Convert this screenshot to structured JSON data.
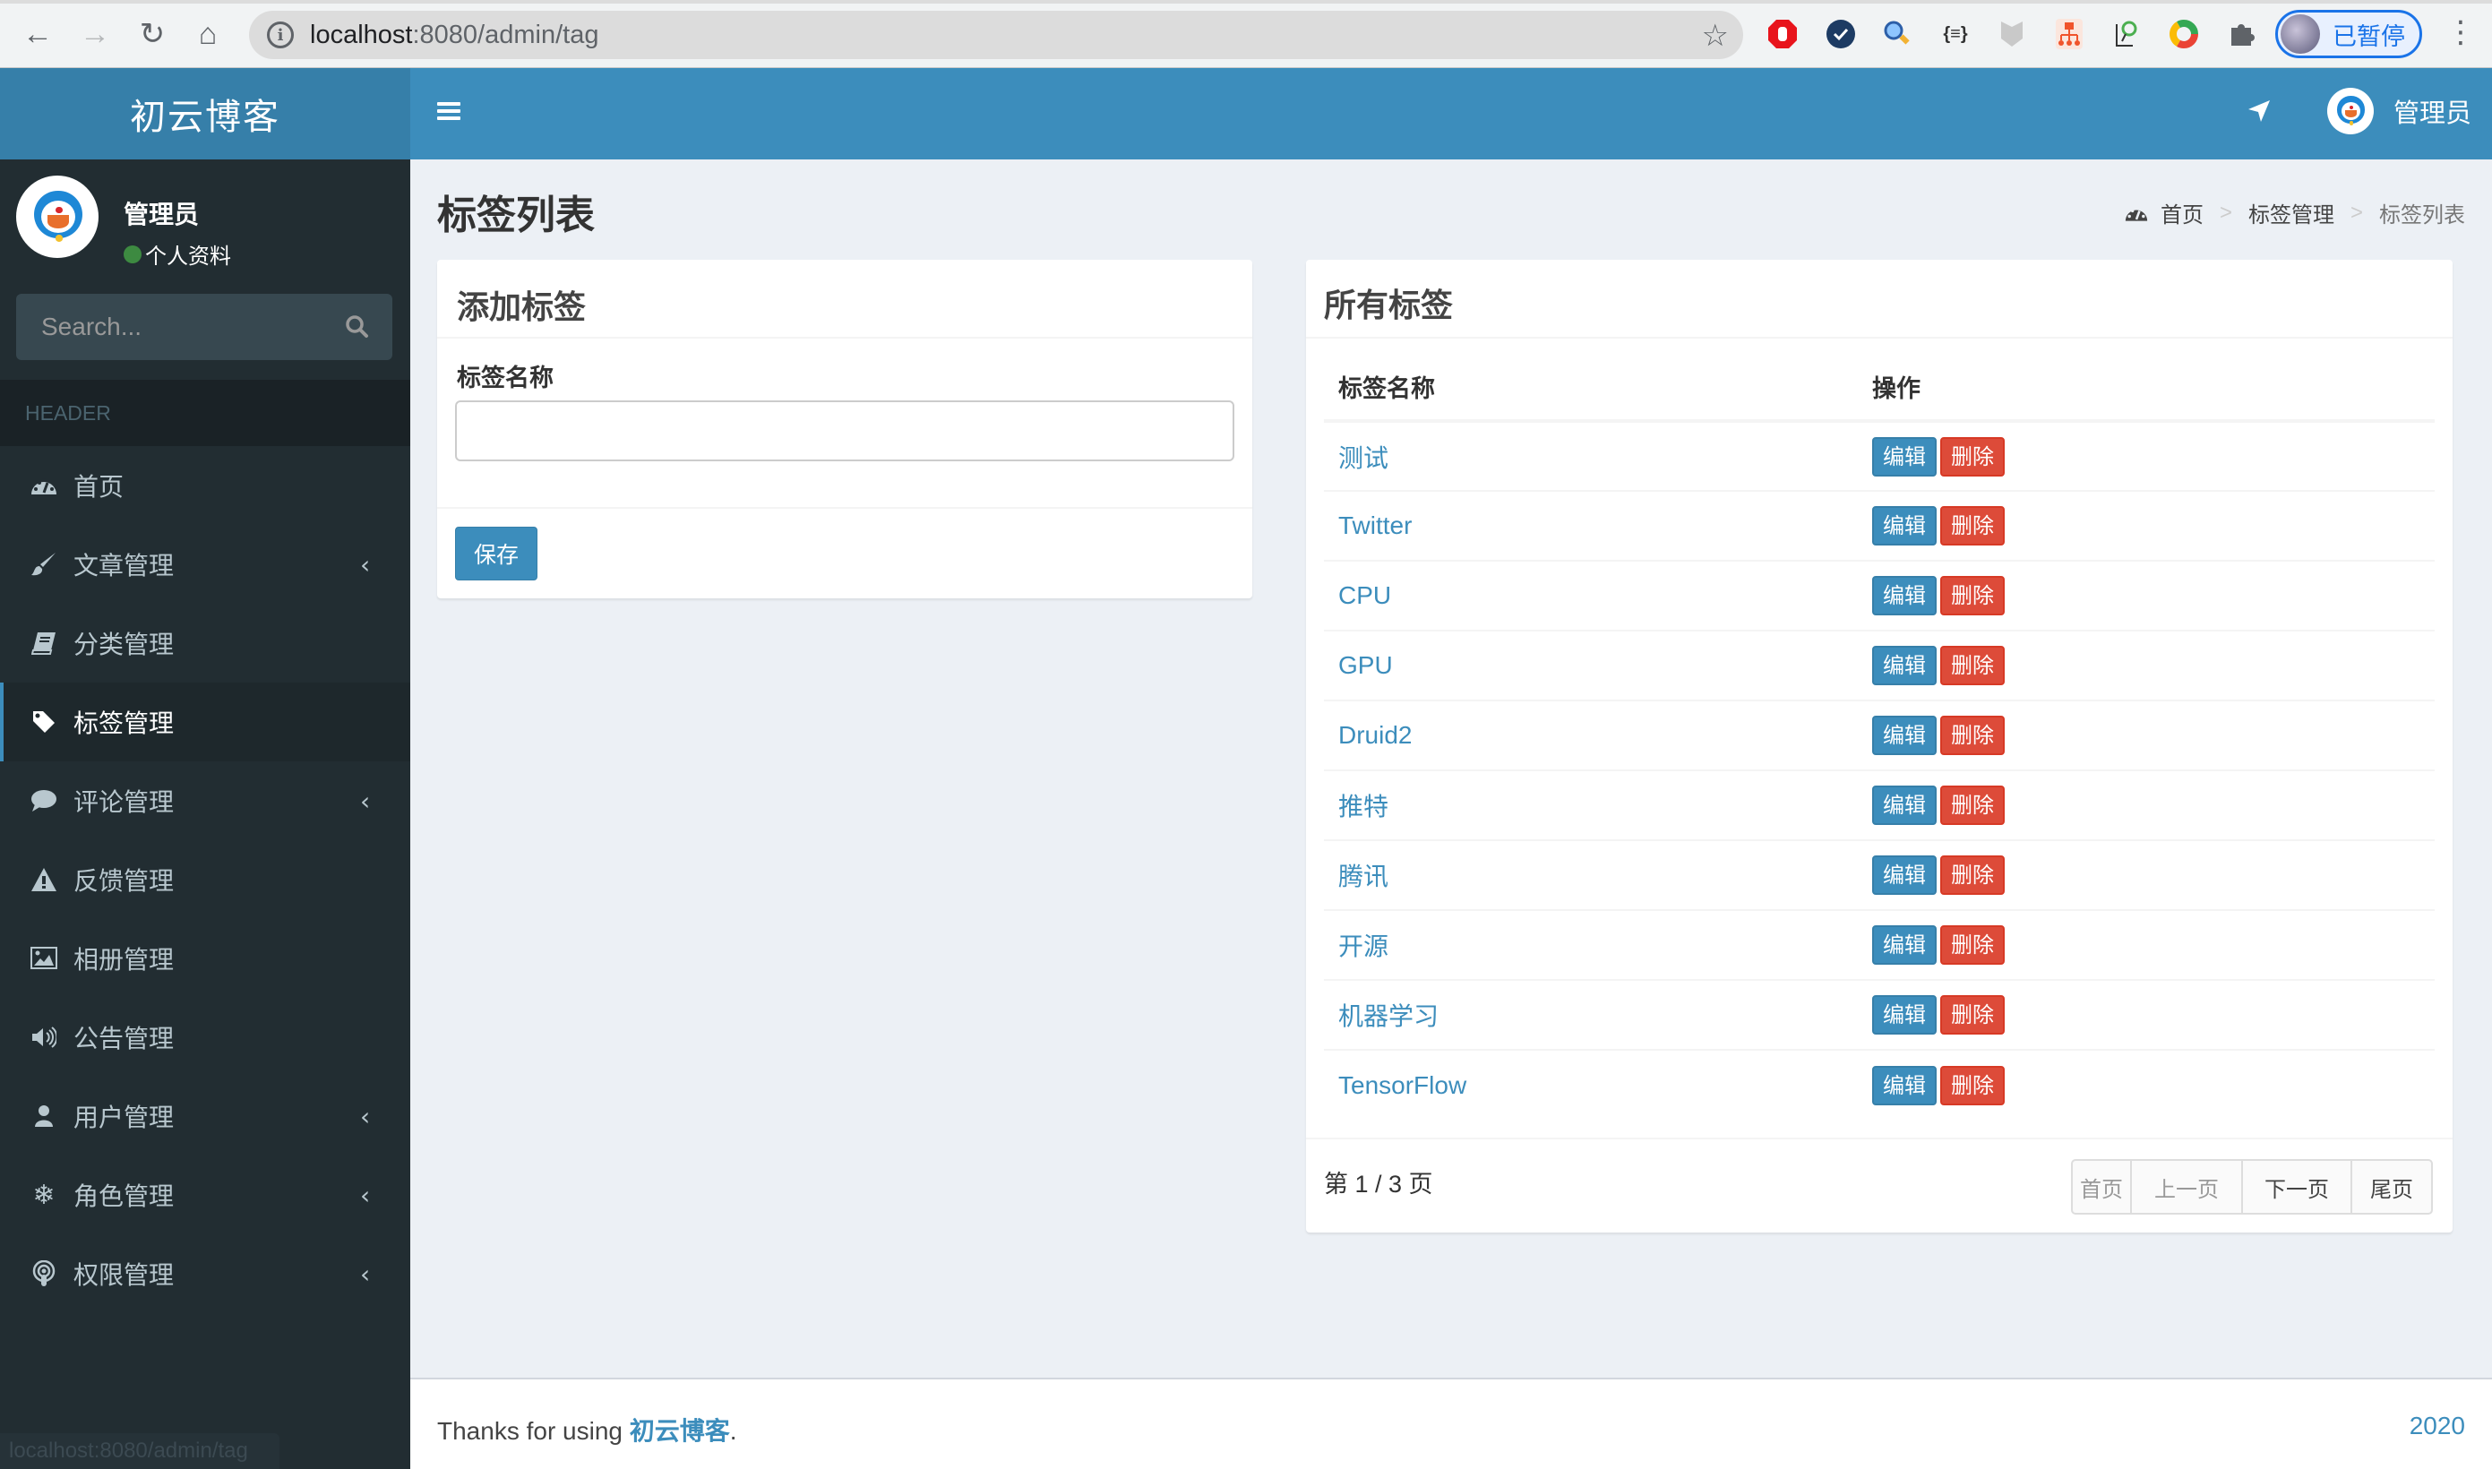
{
  "browser": {
    "url_host": "localhost",
    "url_path": ":8080/admin/tag",
    "profile_label": "已暂停",
    "extensions": [
      "adblock-icon",
      "checkmark-icon",
      "magnifier-icon",
      "json-formatter-icon",
      "shield-icon",
      "sitemap-icon",
      "search-doc-icon",
      "chrome-ring-icon",
      "puzzle-icon"
    ]
  },
  "app": {
    "logo": "初云博客",
    "user_name": "管理员",
    "user_status": "个人资料",
    "search_placeholder": "Search...",
    "sidebar_header": "HEADER"
  },
  "sidebar": {
    "items": [
      {
        "label": "首页",
        "icon": "dashboard-icon",
        "has_children": false,
        "active": false
      },
      {
        "label": "文章管理",
        "icon": "paint-brush-icon",
        "has_children": true,
        "active": false
      },
      {
        "label": "分类管理",
        "icon": "book-icon",
        "has_children": false,
        "active": false
      },
      {
        "label": "标签管理",
        "icon": "tag-icon",
        "has_children": false,
        "active": true
      },
      {
        "label": "评论管理",
        "icon": "comment-icon",
        "has_children": true,
        "active": false
      },
      {
        "label": "反馈管理",
        "icon": "warning-icon",
        "has_children": false,
        "active": false
      },
      {
        "label": "相册管理",
        "icon": "image-icon",
        "has_children": false,
        "active": false
      },
      {
        "label": "公告管理",
        "icon": "volume-icon",
        "has_children": false,
        "active": false
      },
      {
        "label": "用户管理",
        "icon": "user-icon",
        "has_children": true,
        "active": false
      },
      {
        "label": "角色管理",
        "icon": "snowflake-icon",
        "has_children": true,
        "active": false
      },
      {
        "label": "权限管理",
        "icon": "podcast-icon",
        "has_children": true,
        "active": false
      }
    ]
  },
  "page": {
    "title": "标签列表",
    "breadcrumb": [
      "首页",
      "标签管理",
      "标签列表"
    ],
    "breadcrumb_sep": ">"
  },
  "add_form": {
    "title": "添加标签",
    "field_label": "标签名称",
    "field_value": "",
    "save_label": "保存"
  },
  "tag_list": {
    "title": "所有标签",
    "columns": [
      "标签名称",
      "操作"
    ],
    "rows": [
      {
        "name": "测试"
      },
      {
        "name": "Twitter"
      },
      {
        "name": "CPU"
      },
      {
        "name": "GPU"
      },
      {
        "name": "Druid2"
      },
      {
        "name": "推特"
      },
      {
        "name": "腾讯"
      },
      {
        "name": "开源"
      },
      {
        "name": "机器学习"
      },
      {
        "name": "TensorFlow"
      }
    ],
    "edit_label": "编辑",
    "delete_label": "删除",
    "page_info": "第 1 / 3 页",
    "current_page": 1,
    "total_pages": 3,
    "pager": [
      {
        "label": "首页",
        "disabled": true
      },
      {
        "label": "上一页",
        "disabled": true
      },
      {
        "label": "下一页",
        "disabled": false
      },
      {
        "label": "尾页",
        "disabled": false
      }
    ]
  },
  "footer": {
    "prefix": "Thanks for using ",
    "brand": "初云博客",
    "suffix": ".",
    "year": "2020"
  },
  "status_bar": {
    "hover_url": "localhost:8080/admin/tag"
  },
  "colors": {
    "primary": "#3c8dbc",
    "primary_dark": "#367fa9",
    "danger": "#dd4b39",
    "sidebar_bg": "#222d32",
    "content_bg": "#ecf0f5"
  }
}
